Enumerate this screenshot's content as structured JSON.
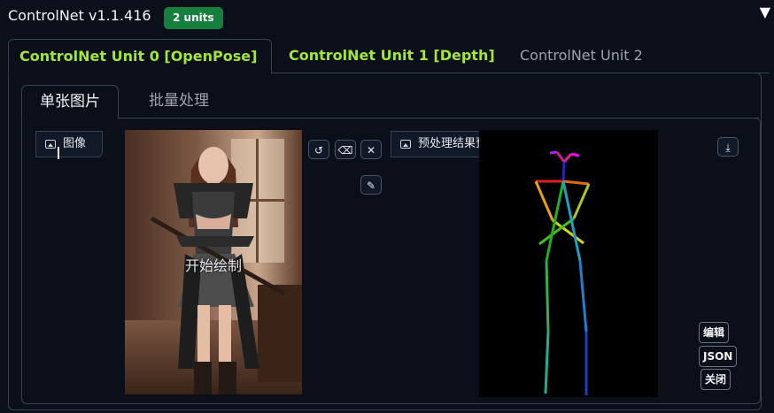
{
  "header": {
    "title": "ControlNet v1.1.416",
    "badge": "2 units",
    "collapse_icon": "▼"
  },
  "unit_tabs": [
    {
      "label": "ControlNet Unit 0 [OpenPose]",
      "active": true,
      "color": "#a3e635"
    },
    {
      "label": "ControlNet Unit 1 [Depth]",
      "active": false,
      "color": "#a3e635"
    },
    {
      "label": "ControlNet Unit 2",
      "active": false,
      "color": "#9ca3af"
    }
  ],
  "inner_tabs": [
    {
      "label": "单张图片",
      "active": true
    },
    {
      "label": "批量处理",
      "active": false
    }
  ],
  "input_image": {
    "label": "图像",
    "overlay_text": "开始绘制",
    "tools": [
      "undo-icon",
      "eraser-icon",
      "close-icon",
      "brush-icon"
    ]
  },
  "preview": {
    "label": "预处理结果预览",
    "download_icon": "download-icon",
    "buttons": {
      "edit": "编辑",
      "json": "JSON",
      "close": "关闭"
    }
  },
  "colors": {
    "accent_green": "#a3e635",
    "badge_green": "#15803d",
    "background": "#0b0f19"
  }
}
